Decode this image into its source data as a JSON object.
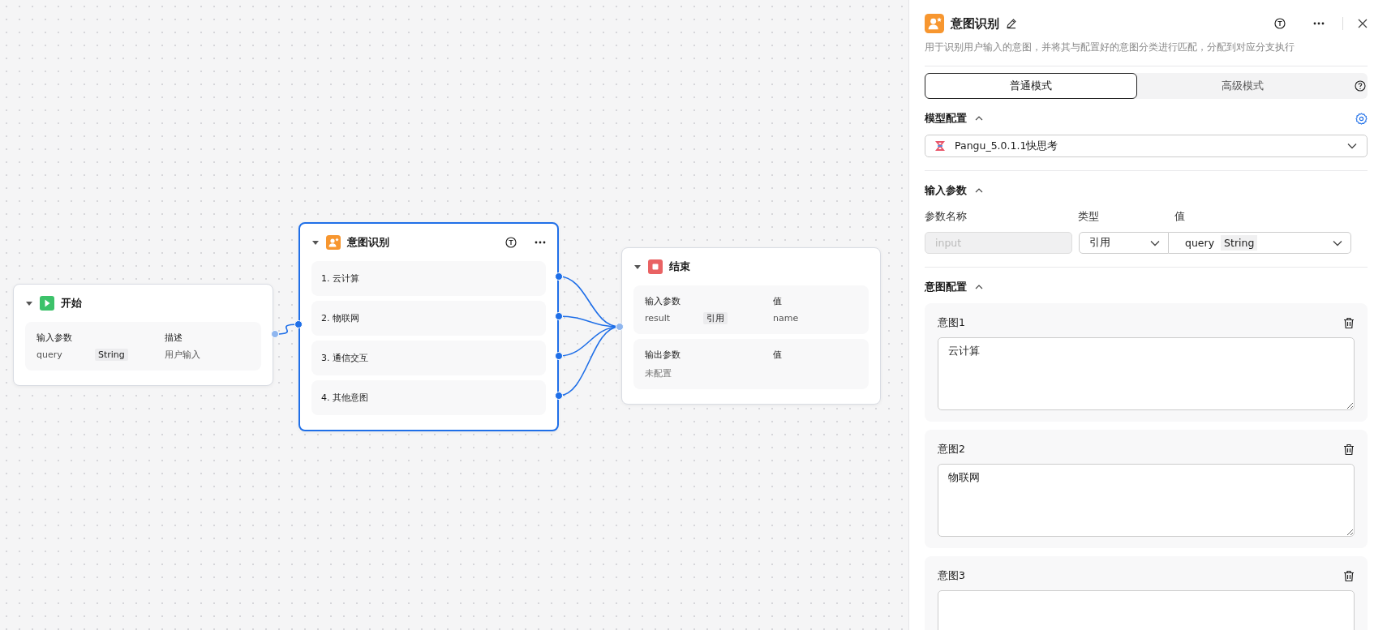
{
  "canvas": {
    "nodes": [
      {
        "kind": "start",
        "title": "开始",
        "selected": false,
        "sections": [
          {
            "headers": [
              "输入参数",
              "描述"
            ],
            "rows": [
              {
                "name": "query",
                "tag": "String",
                "value": "用户输入"
              }
            ]
          }
        ]
      },
      {
        "kind": "intent",
        "title": "意图识别",
        "selected": true,
        "branches": [
          "1. 云计算",
          "2. 物联网",
          "3. 通信交互",
          "4. 其他意图"
        ]
      },
      {
        "kind": "end",
        "title": "结束",
        "selected": false,
        "sections": [
          {
            "headers": [
              "输入参数",
              "值"
            ],
            "rows": [
              {
                "name": "result",
                "tag": "引用",
                "value": "name"
              }
            ]
          },
          {
            "headers": [
              "输出参数",
              "值"
            ],
            "empty_text": "未配置"
          }
        ]
      }
    ]
  },
  "panel": {
    "title": "意图识别",
    "description": "用于识别用户输入的意图，并将其与配置好的意图分类进行匹配，分配到对应分支执行",
    "modes": [
      {
        "label": "普通模式",
        "selected": true
      },
      {
        "label": "高级模式",
        "selected": false
      }
    ],
    "model_section": {
      "title": "模型配置",
      "model": "Pangu_5.0.1.1快思考"
    },
    "input_section": {
      "title": "输入参数",
      "columns": [
        "参数名称",
        "类型",
        "值"
      ],
      "rows": [
        {
          "name": "input",
          "disabled": true,
          "type": "引用",
          "value": "query",
          "value_tag": "String"
        }
      ]
    },
    "intent_section": {
      "title": "意图配置",
      "items": [
        {
          "label": "意图1",
          "text": "云计算"
        },
        {
          "label": "意图2",
          "text": "物联网"
        },
        {
          "label": "意图3"
        }
      ]
    }
  }
}
